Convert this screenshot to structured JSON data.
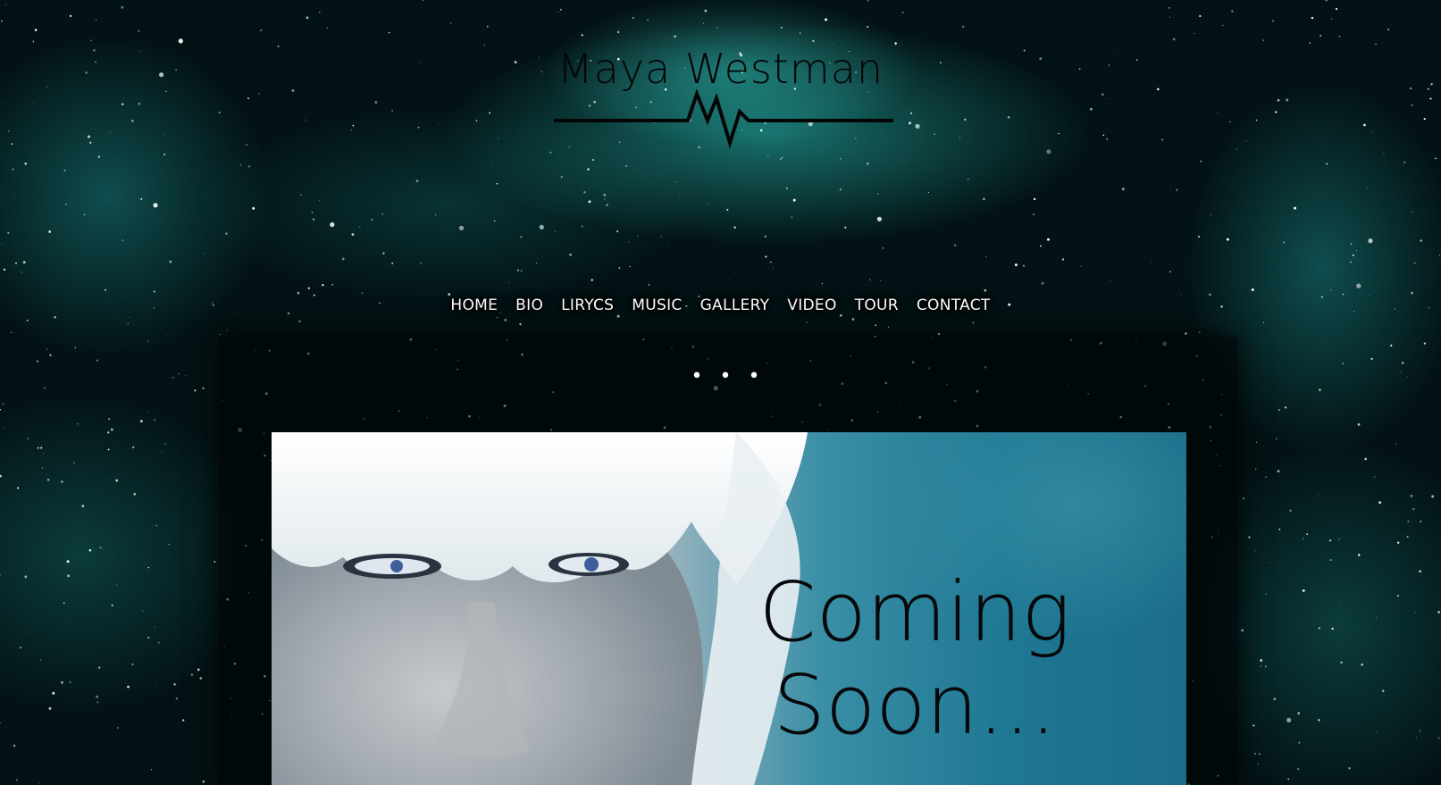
{
  "site": {
    "title": "Maya Westman"
  },
  "nav": {
    "items": [
      {
        "label": "HOME",
        "name": "nav-home"
      },
      {
        "label": "BIO",
        "name": "nav-bio"
      },
      {
        "label": "LIRYCS",
        "name": "nav-lirycs"
      },
      {
        "label": "MUSIC",
        "name": "nav-music"
      },
      {
        "label": "GALLERY",
        "name": "nav-gallery"
      },
      {
        "label": "VIDEO",
        "name": "nav-video"
      },
      {
        "label": "TOUR",
        "name": "nav-tour"
      },
      {
        "label": "CONTACT",
        "name": "nav-contact"
      }
    ]
  },
  "slideshow": {
    "dots": "• • •"
  },
  "hero": {
    "line1": "Coming",
    "line2": "Soon..."
  },
  "colors": {
    "background": "#031214",
    "nebula": "#2bbdb2",
    "nav_text": "#ffffff",
    "title_text": "#050505"
  },
  "icons": {
    "logo_mark": "heartbeat-line-icon"
  }
}
